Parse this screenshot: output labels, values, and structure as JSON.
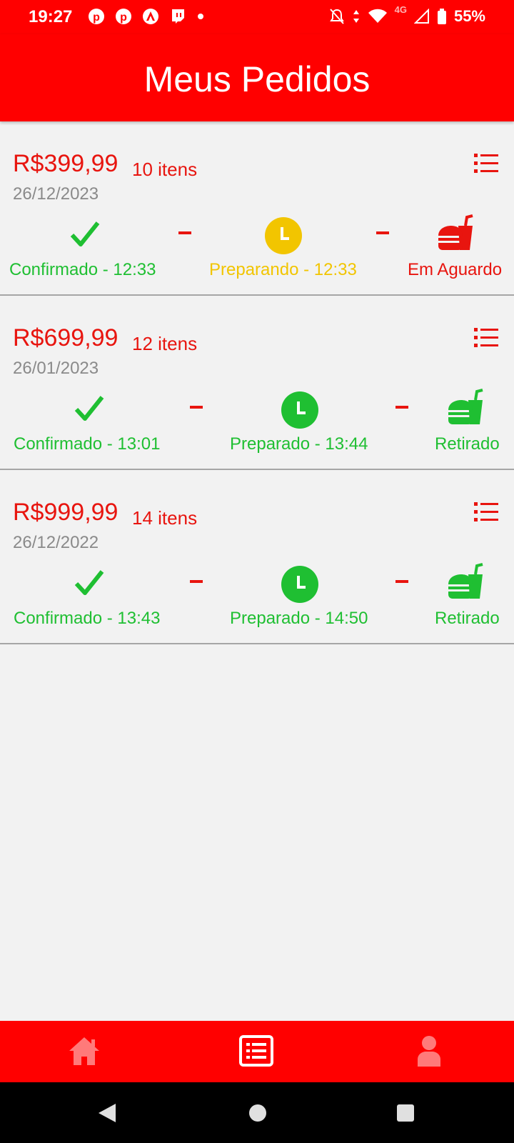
{
  "status_bar": {
    "time": "19:27",
    "battery": "55%",
    "network": "4G",
    "left_icons": [
      "pinterest-icon",
      "pinterest-icon",
      "arch-app-icon",
      "twitch-icon",
      "dot-icon"
    ],
    "right_icons": [
      "notifications-off-icon",
      "data-arrows-icon",
      "wifi-icon",
      "signal-icon",
      "battery-icon"
    ]
  },
  "header": {
    "title": "Meus Pedidos"
  },
  "colors": {
    "brand": "#ff0000",
    "price": "#e8150f",
    "done": "#1fbf32",
    "in_progress": "#f2c500",
    "date": "#8a8a8a"
  },
  "orders": [
    {
      "price": "R$399,99",
      "items": "10 itens",
      "date": "26/12/2023",
      "steps": [
        {
          "label": "Confirmado - 12:33",
          "state": "done",
          "icon": "check-icon"
        },
        {
          "label": "Preparando - 12:33",
          "state": "in_progress",
          "icon": "clock-icon"
        },
        {
          "label": "Em Aguardo",
          "state": "pending",
          "icon": "fast-food-icon"
        }
      ]
    },
    {
      "price": "R$699,99",
      "items": "12 itens",
      "date": "26/01/2023",
      "steps": [
        {
          "label": "Confirmado - 13:01",
          "state": "done",
          "icon": "check-icon"
        },
        {
          "label": "Preparado - 13:44",
          "state": "done",
          "icon": "clock-icon"
        },
        {
          "label": "Retirado",
          "state": "done",
          "icon": "fast-food-icon"
        }
      ]
    },
    {
      "price": "R$999,99",
      "items": "14 itens",
      "date": "26/12/2022",
      "steps": [
        {
          "label": "Confirmado - 13:43",
          "state": "done",
          "icon": "check-icon"
        },
        {
          "label": "Preparado - 14:50",
          "state": "done",
          "icon": "clock-icon"
        },
        {
          "label": "Retirado",
          "state": "done",
          "icon": "fast-food-icon"
        }
      ]
    }
  ],
  "bottom_nav": {
    "items": [
      {
        "icon": "home-icon",
        "active": false
      },
      {
        "icon": "list-icon",
        "active": true
      },
      {
        "icon": "user-icon",
        "active": false
      }
    ]
  },
  "system_nav": {
    "buttons": [
      "back-icon",
      "home-circle-icon",
      "recents-icon"
    ]
  }
}
